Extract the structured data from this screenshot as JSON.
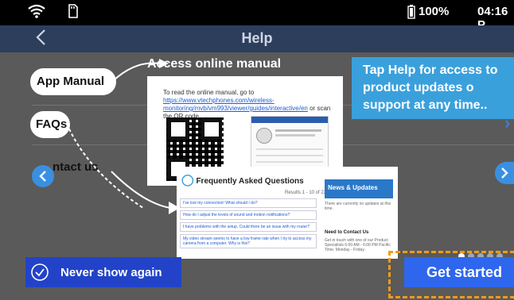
{
  "status": {
    "battery": "100%",
    "time": "04:16 P"
  },
  "header": {
    "title": "Help",
    "back_icon": "chevron-left-icon"
  },
  "menu": [
    {
      "label": "App Manual"
    },
    {
      "label": "FAQs"
    },
    {
      "label": "ntact us"
    }
  ],
  "annotation": {
    "access_manual": "Access online manual"
  },
  "tip": {
    "text": "Tap Help for access to product updates o support at any time.."
  },
  "manual_card": {
    "text1": "To read the online manual, go to",
    "link": "https://www.vtechphones.com/wireless-monitoring/mvb/vm993/viewer/guides/interactive/en",
    "text2": "or scan the QR code."
  },
  "faq_card": {
    "title": "Frequently Asked Questions",
    "results": "Results 1 - 10 of 22",
    "questions": [
      "I've lost my connection! What should I do?",
      "How do I adjust the levels of sound and motion notifications?",
      "I have problems with the setup. Could there be an issue with my router?",
      "My video stream seems to have a low frame rate when I try to access my camera from a computer. Why is this?"
    ],
    "news_title": "News & Updates",
    "news_text": "There are currently no updates at this time.",
    "contact_title": "Need to Contact Us",
    "contact_text": "Get in touch with one of our Product Specialists 6:00 AM - 6:00 PM Pacific Time, Monday - Friday."
  },
  "buttons": {
    "never_show": "Never show again",
    "get_started": "Get started"
  },
  "colors": {
    "accent": "#3aa0dc",
    "cta_border": "#f29a1a"
  }
}
